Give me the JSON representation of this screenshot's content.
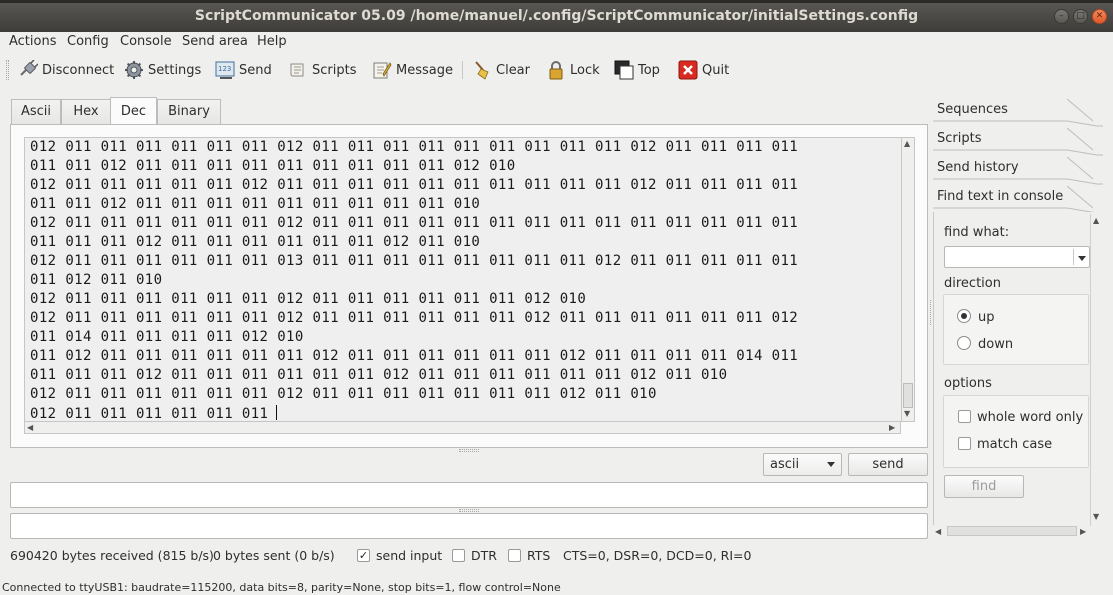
{
  "window": {
    "title": "ScriptCommunicator 05.09  /home/manuel/.config/ScriptCommunicator/initialSettings.config"
  },
  "menu": [
    "Actions",
    "Config",
    "Console",
    "Send area",
    "Help"
  ],
  "toolbar": {
    "disconnect": "Disconnect",
    "settings": "Settings",
    "send": "Send",
    "scripts": "Scripts",
    "message": "Message",
    "clear": "Clear",
    "lock": "Lock",
    "top": "Top",
    "quit": "Quit"
  },
  "tabs": [
    "Ascii",
    "Hex",
    "Dec",
    "Binary"
  ],
  "active_tab": "Dec",
  "console": {
    "lines": [
      "012 011 011 011 011 011 011 012 011 011 011 011 011 011 011 011 011 012 011 011 011 011",
      "011 011 012 011 011 011 011 011 011 011 011 011 012 010",
      "012 011 011 011 011 011 012 011 011 011 011 011 011 011 011 011 011 012 011 011 011 011",
      "011 011 012 011 011 011 011 011 011 011 011 011 010",
      "012 011 011 011 011 011 011 012 011 011 011 011 011 011 011 011 011 011 011 011 011 011",
      "011 011 011 012 011 011 011 011 011 011 012 011 010",
      "012 011 011 011 011 011 011 013 011 011 011 011 011 011 011 011 012 011 011 011 011 011",
      "011 012 011 010",
      "012 011 011 011 011 011 011 012 011 011 011 011 011 011 012 010",
      "012 011 011 011 011 011 011 012 011 011 011 011 011 011 012 011 011 011 011 011 011 012",
      "011 014 011 011 011 011 012 010",
      "011 012 011 011 011 011 011 011 012 011 011 011 011 011 011 012 011 011 011 011 014 011",
      "011 011 011 012 011 011 011 011 011 011 012 011 011 011 011 011 011 012 011 010",
      "012 011 011 011 011 011 011 012 011 011 011 011 011 011 011 012 011 010",
      "012 011 011 011 011 011 011"
    ]
  },
  "send": {
    "format": "ascii",
    "button": "send",
    "input_value": "",
    "second_input_value": ""
  },
  "status": {
    "received": "690420 bytes received (815 b/s)",
    "sent": "0 bytes sent (0 b/s)",
    "send_input_label": "send input",
    "send_input_checked": true,
    "dtr_label": "DTR",
    "dtr_checked": false,
    "rts_label": "RTS",
    "rts_checked": false,
    "lines": "CTS=0, DSR=0, DCD=0, RI=0",
    "connection": "Connected to ttyUSB1: baudrate=115200, data bits=8, parity=None, stop bits=1, flow control=None"
  },
  "right_panel": {
    "tabs": [
      "Sequences",
      "Scripts",
      "Send history",
      "Find text in console"
    ],
    "find_what_label": "find what:",
    "find_what_value": "",
    "direction_label": "direction",
    "direction_up": "up",
    "direction_down": "down",
    "direction_selected": "up",
    "options_label": "options",
    "whole_word_label": "whole word only",
    "whole_word_checked": false,
    "match_case_label": "match case",
    "match_case_checked": false,
    "find_button": "find"
  },
  "colors": {
    "titlebar": "#4a4945",
    "close_button": "#e95e2d",
    "quit_icon": "#d92a22",
    "window_bg": "#efefee"
  }
}
